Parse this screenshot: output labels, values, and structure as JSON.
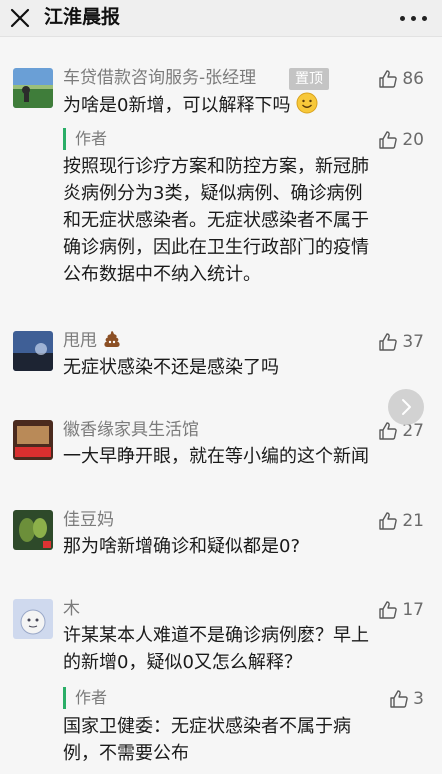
{
  "header": {
    "title": "江淮晨报",
    "close_icon": "close-icon",
    "more_icon": "more-dots-icon"
  },
  "colors": {
    "author_bar": "#2aae67",
    "background": "#f6f6f6",
    "pin_badge": "#c4c4c4"
  },
  "comments": [
    {
      "username": "车贷借款咨询服务-张经理",
      "badge": "置顶",
      "likes": "86",
      "text": "为啥是0新增，可以解释下吗",
      "text_emoji": "smiling-face-emoji",
      "reply": {
        "tag": "作者",
        "likes": "20",
        "lines": [
          "按照现行诊疗方案和防控方案，新冠肺",
          "炎病例分为3类，疑似病例、确诊病例",
          "和无症状感染者。无症状感染者不属于",
          "确诊病例，因此在卫生行政部门的疫情",
          "公布数据中不纳入统计。"
        ]
      }
    },
    {
      "username": "甩甩",
      "name_emoji": "poop-emoji",
      "likes": "37",
      "text": "无症状感染不还是感染了吗"
    },
    {
      "username": "徽香缘家具生活馆",
      "likes": "27",
      "text": "一大早睁开眼，就在等小编的这个新闻"
    },
    {
      "username": "佳豆妈",
      "likes": "21",
      "text": "那为啥新增确诊和疑似都是0?"
    },
    {
      "username": "木",
      "likes": "17",
      "lines": [
        "许某某本人难道不是确诊病例麽？早上",
        "的新增0，疑似0又怎么解释？"
      ],
      "reply": {
        "tag": "作者",
        "likes": "3",
        "lines": [
          "国家卫健委：无症状感染者不属于病",
          "例，不需要公布"
        ]
      }
    }
  ]
}
